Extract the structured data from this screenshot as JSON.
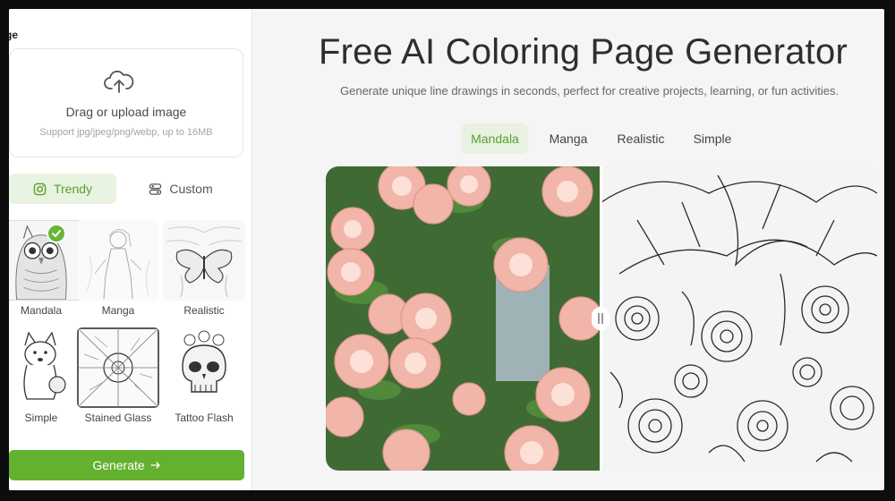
{
  "left_panel": {
    "heading": "ge",
    "upload": {
      "title": "Drag or upload image",
      "hint": "Support jpg/jpeg/png/webp, up to 16MB",
      "icon": "cloud-upload-icon"
    },
    "mode_tabs": [
      {
        "label": "Trendy",
        "icon": "instagram-icon",
        "active": true
      },
      {
        "label": "Custom",
        "icon": "sliders-icon",
        "active": false
      }
    ],
    "styles": [
      {
        "label": "Mandala",
        "selected": true
      },
      {
        "label": "Manga",
        "selected": false
      },
      {
        "label": "Realistic",
        "selected": false
      },
      {
        "label": "Simple",
        "selected": false
      },
      {
        "label": "Stained Glass",
        "selected": false
      },
      {
        "label": "Tattoo Flash",
        "selected": false
      }
    ],
    "generate_label": "Generate",
    "generate_icon": "arrow-right-icon"
  },
  "main": {
    "title": "Free AI Coloring Page Generator",
    "subtitle": "Generate unique line drawings in seconds, perfect for creative projects, learning, or fun activities.",
    "style_tabs": [
      {
        "label": "Mandala",
        "active": true
      },
      {
        "label": "Manga",
        "active": false
      },
      {
        "label": "Realistic",
        "active": false
      },
      {
        "label": "Simple",
        "active": false
      }
    ]
  },
  "colors": {
    "accent": "#64b12f",
    "accent_light": "#e9f3e1",
    "title": "#2e2e2e"
  }
}
